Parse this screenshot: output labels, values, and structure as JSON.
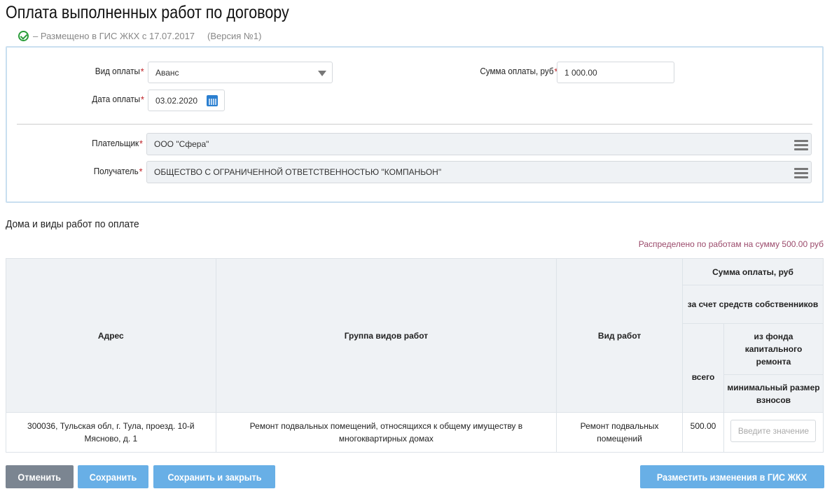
{
  "page": {
    "title": "Оплата выполненных работ по договору",
    "status": "–  Размещено в ГИС ЖКХ с 17.07.2017",
    "version": "(Версия №1)"
  },
  "form": {
    "payment_type": {
      "label": "Вид оплаты",
      "value": "Аванс"
    },
    "amount": {
      "label": "Сумма оплаты, руб",
      "value": "1 000.00"
    },
    "date": {
      "label": "Дата оплаты",
      "value": "03.02.2020"
    },
    "payer": {
      "label": "Плательщик",
      "value": "ООО \"Сфера\""
    },
    "recipient": {
      "label": "Получатель",
      "value": "ОБЩЕСТВО С ОГРАНИЧЕННОЙ ОТВЕТСТВЕННОСТЬЮ \"КОМПАНЬОН\""
    },
    "required_mark": "*"
  },
  "section": {
    "title": "Дома и виды работ по оплате",
    "distributed": "Распределено по работам на сумму 500.00 руб"
  },
  "table": {
    "headers": {
      "address": "Адрес",
      "work_group": "Группа видов работ",
      "work_type": "Вид работ",
      "sum": "Сумма оплаты, руб",
      "owners": "за счет средств собственников",
      "total": "всего",
      "fund": "из фонда капитального ремонта",
      "min": "минимальный размер взносов"
    },
    "rows": [
      {
        "address": "300036, Тульская обл, г. Тула, проезд. 10-й Мясново, д. 1",
        "work_group": "Ремонт подвальных помещений, относящихся к общему имуществу в многоквартирных домах",
        "work_type": "Ремонт подвальных помещений",
        "total": "500.00",
        "min_placeholder": "Введите значение"
      }
    ]
  },
  "buttons": {
    "cancel": "Отменить",
    "save": "Сохранить",
    "save_close": "Сохранить и закрыть",
    "publish": "Разместить изменения в ГИС ЖКХ"
  }
}
